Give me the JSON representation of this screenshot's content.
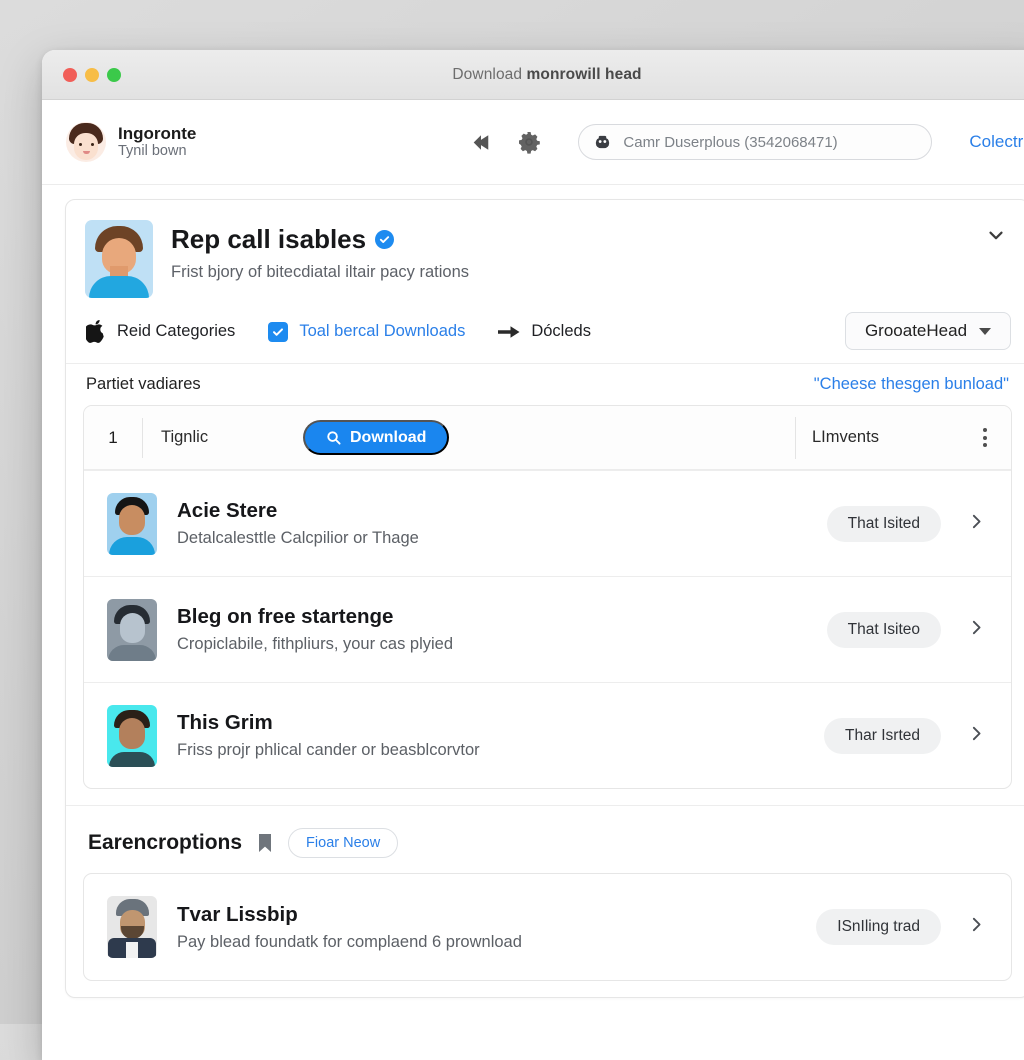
{
  "window": {
    "title_prefix": "Download ",
    "title_bold": "monrowill head",
    "traffic": {
      "close": "close-button",
      "minimize": "minimize-button",
      "zoom": "zoom-button"
    }
  },
  "header": {
    "user_name": "Ingoronte",
    "user_sub": "Tynil bown",
    "back_icon": "back-arrow-icon",
    "settings_icon": "gear-icon",
    "search": {
      "icon": "search-icon",
      "value": "Camr Duserplous (3542068471)"
    },
    "link": "Colectries"
  },
  "profile": {
    "title": "Rep call isables",
    "verified_icon": "verified-badge-icon",
    "subtitle": "Frist bjory of bitecdiatal iltair pacy rations",
    "collapse_icon": "chevron-down-icon",
    "filters": [
      {
        "label": "Reid Categories",
        "icon": "apple-icon",
        "type": "icon",
        "active": false
      },
      {
        "label": "Toal bercal Downloads",
        "icon": "checkbox-checked-icon",
        "type": "checkbox",
        "active": true
      },
      {
        "label": "Dócleds",
        "icon": "arrow-right-icon",
        "type": "icon",
        "active": false
      }
    ],
    "dropdown": {
      "label": "GrooateHead",
      "icon": "chevron-down-icon"
    }
  },
  "section": {
    "title": "Partiet vadiares",
    "link": "\"Cheese thesgen bunload\""
  },
  "list_header": {
    "number": "1",
    "label": "Tignlic",
    "download_button": "Download",
    "download_icon": "search-icon",
    "right_label": "LImvents",
    "menu_icon": "kebab-menu-icon"
  },
  "rows": [
    {
      "title": "Acie Stere",
      "subtitle": "Detalcalesttle Calcpilior or Thage",
      "badge": "That  Isited",
      "avatar": "avatar-blue",
      "chevron": "chevron-right-icon"
    },
    {
      "title": "Bleg on free startenge",
      "subtitle": "Cropiclabile, fithpliurs, your cas plyied",
      "badge": "That  Isiteo",
      "avatar": "avatar-grey",
      "chevron": "chevron-right-icon"
    },
    {
      "title": "This Grim",
      "subtitle": "Friss projr phlical cander or beasblcorvtor",
      "badge": "Thar  Isrted",
      "avatar": "avatar-cyan",
      "chevron": "chevron-right-icon"
    }
  ],
  "bottom": {
    "title": "Earencroptions",
    "icon": "bookmark-icon",
    "pill": "Fioar Neow",
    "rows": [
      {
        "title": "Tvar Lissbip",
        "subtitle": "Pay blead foundatk for complaend 6 prownload",
        "badge": "ISnIling trad",
        "avatar": "avatar-cap",
        "chevron": "chevron-right-icon"
      }
    ]
  },
  "colors": {
    "accent_blue": "#1d8bf0",
    "link_blue": "#2a7fe8",
    "download_button": "#1a86ef",
    "badge_bg": "#f0f1f2",
    "window_bg": "#ffffff"
  }
}
